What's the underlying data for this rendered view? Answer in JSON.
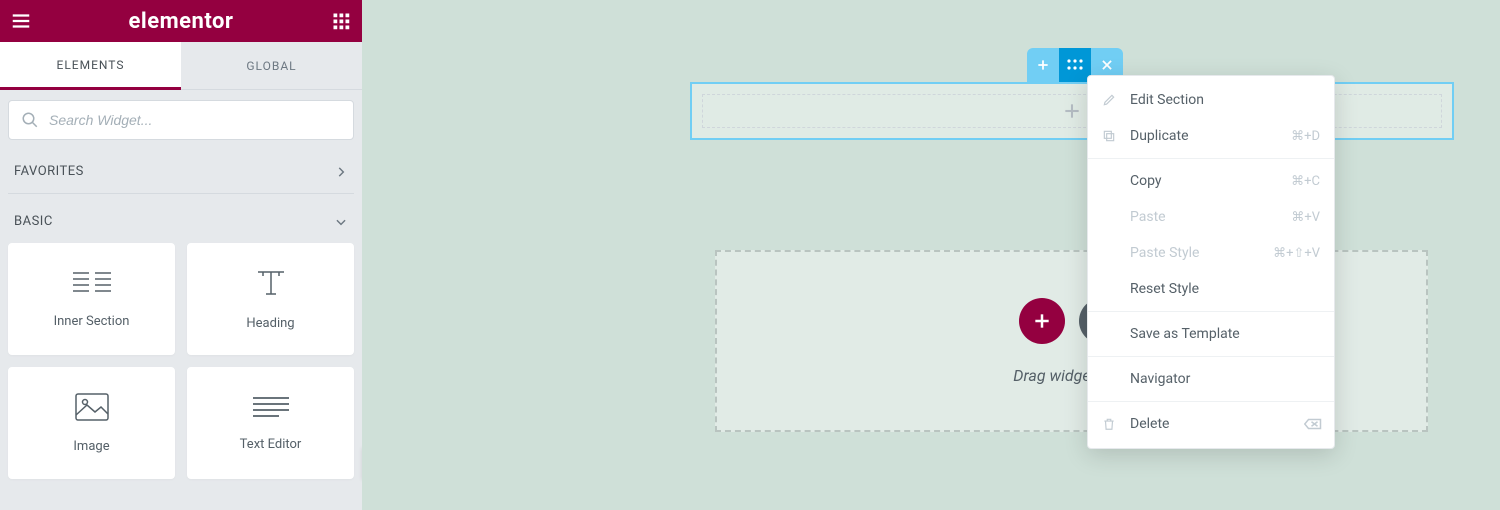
{
  "brand": {
    "name": "elementor",
    "color": "#940040"
  },
  "tabs": {
    "elements": "ELEMENTS",
    "global": "GLOBAL",
    "active": "elements"
  },
  "search": {
    "placeholder": "Search Widget..."
  },
  "categories": {
    "favorites": "FAVORITES",
    "basic": "BASIC"
  },
  "widgets": {
    "inner_section": "Inner Section",
    "heading": "Heading",
    "image": "Image",
    "text_editor": "Text Editor"
  },
  "canvas": {
    "dropzone_text": "Drag widget here",
    "section_toolbar": {
      "add": "Add",
      "drag": "Drag",
      "close": "Close"
    }
  },
  "context_menu": {
    "edit_section": "Edit Section",
    "duplicate": "Duplicate",
    "copy": "Copy",
    "paste": "Paste",
    "paste_style": "Paste Style",
    "reset_style": "Reset Style",
    "save_as_template": "Save as Template",
    "navigator": "Navigator",
    "delete": "Delete",
    "shortcuts": {
      "duplicate": "⌘+D",
      "copy": "⌘+C",
      "paste": "⌘+V",
      "paste_style": "⌘+⇧+V"
    }
  }
}
